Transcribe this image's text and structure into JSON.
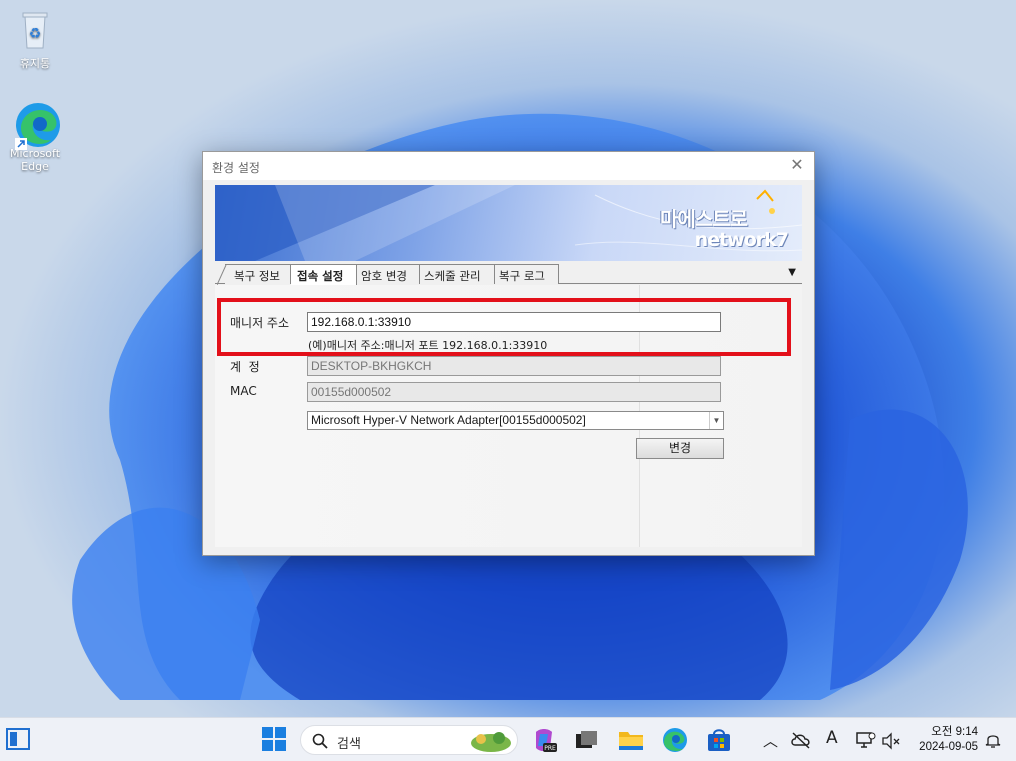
{
  "desktop": {
    "icons": [
      {
        "label": "휴지통",
        "icon": "recycle-bin-icon"
      },
      {
        "label": "Microsoft Edge",
        "icon": "edge-icon"
      }
    ]
  },
  "dialog": {
    "title": "환경 설정",
    "close": "✕",
    "logo_main": "마에스트로",
    "logo_sub": "network7",
    "tabs": [
      {
        "label": "복구 정보",
        "active": false
      },
      {
        "label": "접속 설정",
        "active": true
      },
      {
        "label": "암호 변경",
        "active": false
      },
      {
        "label": "스케줄 관리",
        "active": false
      },
      {
        "label": "복구 로그",
        "active": false
      }
    ],
    "tabs_more": "▼",
    "form": {
      "manager_label": "매니저 주소",
      "manager_value": "192.168.0.1:33910",
      "manager_hint": "(예)매니저 주소:매니저 포트 192.168.0.1:33910",
      "account_label": "계  정",
      "account_value": "DESKTOP-BKHGKCH",
      "mac_label": "MAC",
      "mac_value": "00155d000502",
      "adapter_value": "Microsoft Hyper-V Network Adapter[00155d000502]",
      "change_button": "변경"
    }
  },
  "taskbar": {
    "search_text": "검색",
    "clock_time": "오전 9:14",
    "clock_date": "2024-09-05",
    "ime_label": "A"
  },
  "colors": {
    "highlight": "#e3101a",
    "accent": "#1a47c8"
  }
}
